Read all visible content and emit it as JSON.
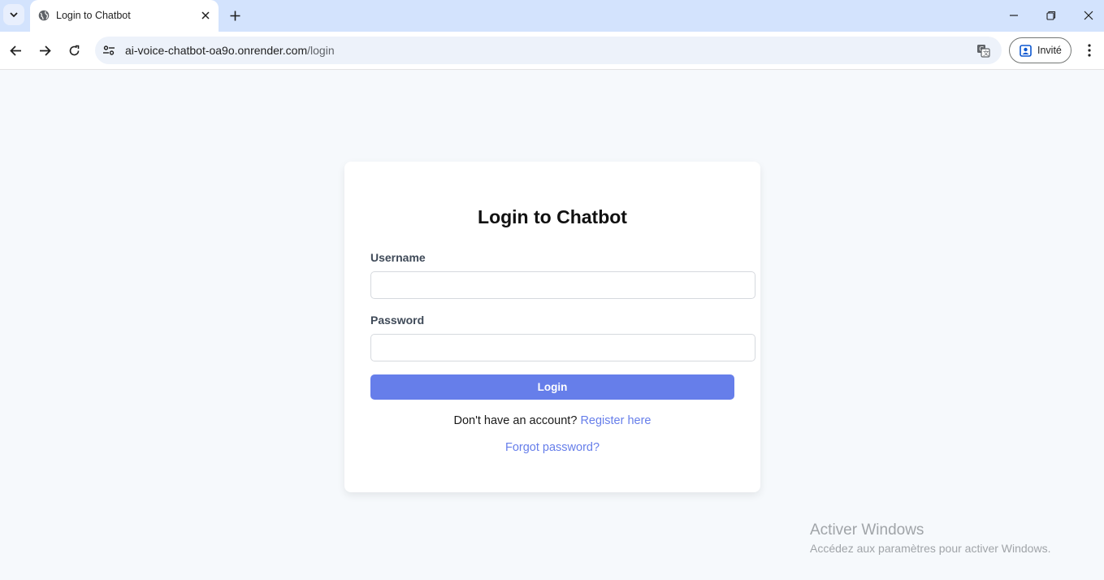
{
  "browser": {
    "tab_title": "Login to Chatbot",
    "url_host": "ai-voice-chatbot-oa9o.onrender.com",
    "url_path": "/login",
    "profile_label": "Invité",
    "icons": [
      "tab-search-icon",
      "globe-icon",
      "close-icon",
      "plus-icon",
      "minimize-icon",
      "restore-icon",
      "close-window-icon",
      "back-arrow-icon",
      "forward-arrow-icon",
      "reload-icon",
      "site-settings-icon",
      "translate-icon",
      "person-icon",
      "more-vert-icon"
    ]
  },
  "login": {
    "title": "Login to Chatbot",
    "username_label": "Username",
    "username_value": "",
    "password_label": "Password",
    "password_value": "",
    "submit_label": "Login",
    "no_account_text": "Don't have an account?",
    "register_link": "Register here",
    "forgot_link": "Forgot password?"
  },
  "watermark": {
    "title": "Activer Windows",
    "subtitle": "Accédez aux paramètres pour activer Windows."
  },
  "colors": {
    "accent": "#667eea",
    "page_bg": "#f6f9fc",
    "tabbar_bg": "#d3e3fd"
  }
}
